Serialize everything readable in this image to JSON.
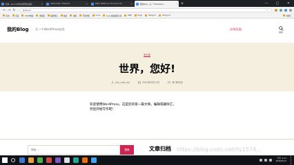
{
  "browser": {
    "tabs": [
      {
        "title": "简体 - 从Linux作业的原理出发构..."
      },
      {
        "title": "Client Area - Freenom"
      },
      {
        "title": "DNS | fbsfa.ml | Account | Clo..."
      },
      {
        "title": "我的Blog - 又一个WordPres...",
        "active": true
      }
    ],
    "new_tab": "+",
    "window_controls": [
      "—",
      "□",
      "✕"
    ],
    "url": "fbsfa.ml",
    "bookmarks": [
      "应用",
      "百度",
      "CSDN博客",
      "博客园",
      "编程笔记",
      "极客",
      "搜狐",
      "开源中国",
      "Linux",
      "Linux系统运维之家",
      "ARM",
      "Hugo",
      "Yilang.cn",
      "Yilong Lin",
      "Other"
    ],
    "other_bookmarks": "书签栏"
  },
  "site": {
    "title": "我的Blog",
    "description": "又一个WordPress站点",
    "nav_item": "示例页面",
    "search_label": "搜索"
  },
  "post": {
    "category": "未分类",
    "title": "世界，您好!",
    "author": "jlily_root_wp",
    "date": "2020年5月12日",
    "comments": "有1条评论",
    "content_line1": "欢迎使用WordPress。这是您的第一篇文章。编辑或删除它，",
    "content_line2": "然后开始写作吧！"
  },
  "footer": {
    "search_placeholder": "搜索 ...",
    "search_button": "搜索",
    "archives_title": "文章归档",
    "watermark": "https://blog.csdn.net/lly1574..."
  },
  "taskbar": {
    "time": "下午 4:11",
    "date": "2020/5/13",
    "app_colors": [
      "#3a7bd5",
      "#e8a33d",
      "#4caf50",
      "#d64541",
      "#7e57c2",
      "#e0e0e0",
      "#26a69a",
      "#ef6c00",
      "#42a5f5"
    ]
  },
  "colors": {
    "accent": "#cd2653",
    "header_bg": "#f5efe0"
  }
}
